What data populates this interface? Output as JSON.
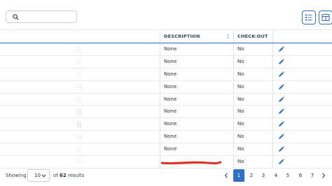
{
  "toolbar": {
    "search_value": "",
    "columns_icon": "list-settings-icon",
    "layout_icon": "panel-layout-icon"
  },
  "table": {
    "columns": [
      {
        "key": "description",
        "label": "DESCRIPTION"
      },
      {
        "key": "checkout",
        "label": "CHECK-OUT"
      }
    ],
    "rows": [
      {
        "description": "None",
        "checkout": "No"
      },
      {
        "description": "None",
        "checkout": "No"
      },
      {
        "description": "None",
        "checkout": "No"
      },
      {
        "description": "None",
        "checkout": "No"
      },
      {
        "description": "None",
        "checkout": "No"
      },
      {
        "description": "None",
        "checkout": "No"
      },
      {
        "description": "None",
        "checkout": "No"
      },
      {
        "description": "None",
        "checkout": "No"
      },
      {
        "description": "None",
        "checkout": "No"
      },
      {
        "description": "",
        "checkout": "No"
      }
    ],
    "edit_icon": "pencil-icon",
    "drag_icon": "drag-handle-icon",
    "accent_color": "#2e72c6",
    "redaction_color": "#e0301e"
  },
  "footer": {
    "showing_label": "Showing",
    "page_size": "10",
    "total_prefix": "of",
    "total_count": "62",
    "total_suffix": "results",
    "pages": [
      "1",
      "2",
      "3",
      "4",
      "5",
      "6",
      "7"
    ],
    "current_page": "1"
  }
}
